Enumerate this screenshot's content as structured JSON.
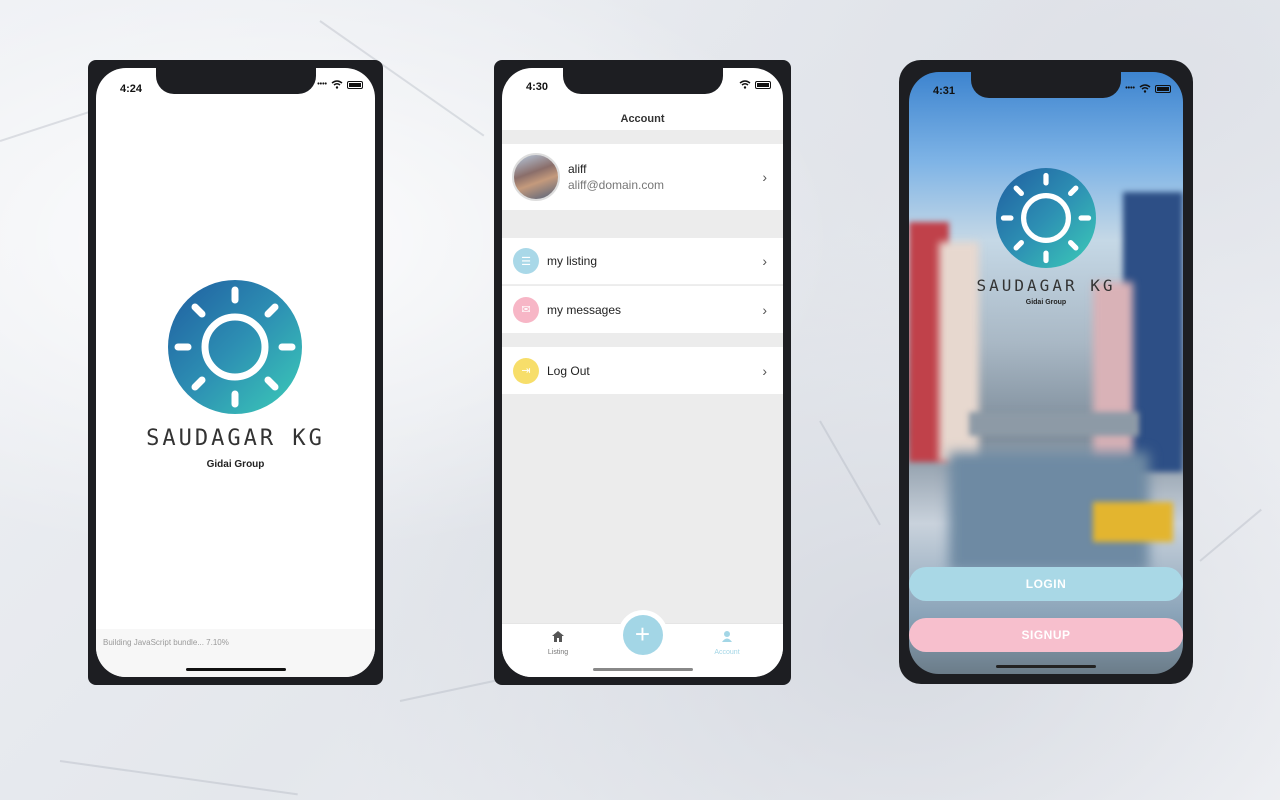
{
  "phone1": {
    "time": "4:24",
    "brand": "SAUDAGAR KG",
    "subtitle": "Gidai Group",
    "bundle_status": "Building JavaScript bundle... 7.10%"
  },
  "phone2": {
    "time": "4:30",
    "title": "Account",
    "user": {
      "name": "aliff",
      "email": "aliff@domain.com"
    },
    "menu": [
      {
        "label": "my listing",
        "icon": "list-icon",
        "color": "#a9d8e8"
      },
      {
        "label": "my messages",
        "icon": "mail-icon",
        "color": "#f7b6c6"
      },
      {
        "label": "Log Out",
        "icon": "logout-icon",
        "color": "#f7de6a"
      }
    ],
    "tabs": [
      {
        "label": "Listing",
        "icon": "home-icon"
      },
      {
        "label": "Account",
        "icon": "person-icon"
      }
    ],
    "accent": "#a3d6e6"
  },
  "phone3": {
    "time": "4:31",
    "brand": "SAUDAGAR KG",
    "subtitle": "Gidai Group",
    "login_label": "LOGIN",
    "signup_label": "SIGNUP",
    "login_color": "#a9d8e6",
    "signup_color": "#f7bfcd"
  }
}
